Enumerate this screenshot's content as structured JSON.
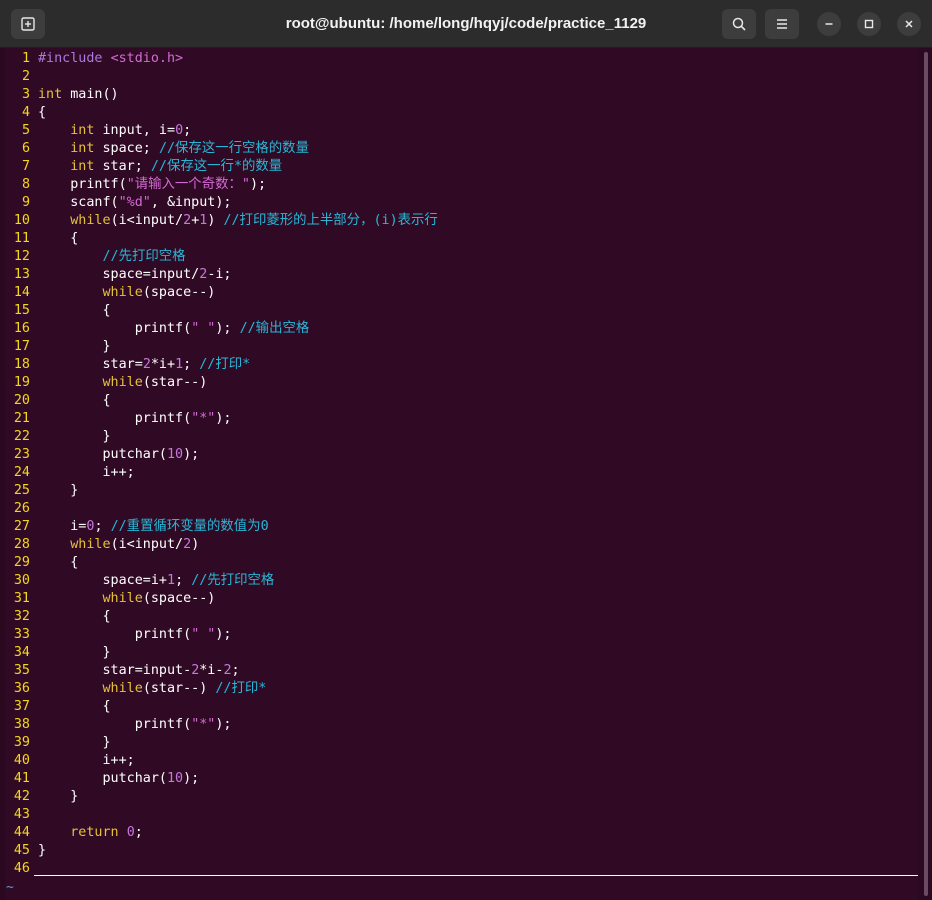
{
  "window": {
    "title": "root@ubuntu: /home/long/hqyj/code/practice_1129"
  },
  "icons": {
    "new_tab": "new-tab-icon",
    "search": "search-icon",
    "menu": "hamburger-menu-icon",
    "minimize": "minimize-icon",
    "maximize": "maximize-icon",
    "close": "close-icon"
  },
  "colors": {
    "background": "#300a24",
    "line_numbers": "#f5d61e",
    "keyword": "#e5c23a",
    "comment": "#29b6d6",
    "string": "#d46ad4",
    "number": "#c678dd"
  },
  "editor": {
    "lines": [
      {
        "num": "1",
        "tokens": [
          [
            "p",
            "#include "
          ],
          [
            "s",
            "<stdio.h>"
          ]
        ]
      },
      {
        "num": "2",
        "tokens": []
      },
      {
        "num": "3",
        "tokens": [
          [
            "k",
            "int"
          ],
          [
            "t",
            " main()"
          ]
        ]
      },
      {
        "num": "4",
        "tokens": [
          [
            "t",
            "{"
          ]
        ]
      },
      {
        "num": "5",
        "tokens": [
          [
            "t",
            "    "
          ],
          [
            "k",
            "int"
          ],
          [
            "t",
            " input, i="
          ],
          [
            "n",
            "0"
          ],
          [
            "t",
            ";"
          ]
        ]
      },
      {
        "num": "6",
        "tokens": [
          [
            "t",
            "    "
          ],
          [
            "k",
            "int"
          ],
          [
            "t",
            " space; "
          ],
          [
            "c",
            "//保存这一行空格的数量"
          ]
        ]
      },
      {
        "num": "7",
        "tokens": [
          [
            "t",
            "    "
          ],
          [
            "k",
            "int"
          ],
          [
            "t",
            " star; "
          ],
          [
            "c",
            "//保存这一行*的数量"
          ]
        ]
      },
      {
        "num": "8",
        "tokens": [
          [
            "t",
            "    printf("
          ],
          [
            "s",
            "\"请输入一个奇数：\""
          ],
          [
            "t",
            ");"
          ]
        ]
      },
      {
        "num": "9",
        "tokens": [
          [
            "t",
            "    scanf("
          ],
          [
            "s",
            "\"%d\""
          ],
          [
            "t",
            ", &input);"
          ]
        ]
      },
      {
        "num": "10",
        "tokens": [
          [
            "t",
            "    "
          ],
          [
            "k",
            "while"
          ],
          [
            "t",
            "(i<input/"
          ],
          [
            "n",
            "2"
          ],
          [
            "t",
            "+"
          ],
          [
            "n",
            "1"
          ],
          [
            "t",
            ") "
          ],
          [
            "c",
            "//打印菱形的上半部分，(i)表示行"
          ]
        ]
      },
      {
        "num": "11",
        "tokens": [
          [
            "t",
            "    {"
          ]
        ]
      },
      {
        "num": "12",
        "tokens": [
          [
            "t",
            "        "
          ],
          [
            "c",
            "//先打印空格"
          ]
        ]
      },
      {
        "num": "13",
        "tokens": [
          [
            "t",
            "        space=input/"
          ],
          [
            "n",
            "2"
          ],
          [
            "t",
            "-i;"
          ]
        ]
      },
      {
        "num": "14",
        "tokens": [
          [
            "t",
            "        "
          ],
          [
            "k",
            "while"
          ],
          [
            "t",
            "(space--)"
          ]
        ]
      },
      {
        "num": "15",
        "tokens": [
          [
            "t",
            "        {"
          ]
        ]
      },
      {
        "num": "16",
        "tokens": [
          [
            "t",
            "            printf("
          ],
          [
            "s",
            "\" \""
          ],
          [
            "t",
            "); "
          ],
          [
            "c",
            "//输出空格"
          ]
        ]
      },
      {
        "num": "17",
        "tokens": [
          [
            "t",
            "        }"
          ]
        ]
      },
      {
        "num": "18",
        "tokens": [
          [
            "t",
            "        star="
          ],
          [
            "n",
            "2"
          ],
          [
            "t",
            "*i+"
          ],
          [
            "n",
            "1"
          ],
          [
            "t",
            "; "
          ],
          [
            "c",
            "//打印*"
          ]
        ]
      },
      {
        "num": "19",
        "tokens": [
          [
            "t",
            "        "
          ],
          [
            "k",
            "while"
          ],
          [
            "t",
            "(star--)"
          ]
        ]
      },
      {
        "num": "20",
        "tokens": [
          [
            "t",
            "        {"
          ]
        ]
      },
      {
        "num": "21",
        "tokens": [
          [
            "t",
            "            printf("
          ],
          [
            "s",
            "\"*\""
          ],
          [
            "t",
            ");"
          ]
        ]
      },
      {
        "num": "22",
        "tokens": [
          [
            "t",
            "        }"
          ]
        ]
      },
      {
        "num": "23",
        "tokens": [
          [
            "t",
            "        putchar("
          ],
          [
            "n",
            "10"
          ],
          [
            "t",
            ");"
          ]
        ]
      },
      {
        "num": "24",
        "tokens": [
          [
            "t",
            "        i++;"
          ]
        ]
      },
      {
        "num": "25",
        "tokens": [
          [
            "t",
            "    }"
          ]
        ]
      },
      {
        "num": "26",
        "tokens": []
      },
      {
        "num": "27",
        "tokens": [
          [
            "t",
            "    i="
          ],
          [
            "n",
            "0"
          ],
          [
            "t",
            "; "
          ],
          [
            "c",
            "//重置循环变量的数值为0"
          ]
        ]
      },
      {
        "num": "28",
        "tokens": [
          [
            "t",
            "    "
          ],
          [
            "k",
            "while"
          ],
          [
            "t",
            "(i<input/"
          ],
          [
            "n",
            "2"
          ],
          [
            "t",
            ")"
          ]
        ]
      },
      {
        "num": "29",
        "tokens": [
          [
            "t",
            "    {"
          ]
        ]
      },
      {
        "num": "30",
        "tokens": [
          [
            "t",
            "        space=i+"
          ],
          [
            "n",
            "1"
          ],
          [
            "t",
            "; "
          ],
          [
            "c",
            "//先打印空格"
          ]
        ]
      },
      {
        "num": "31",
        "tokens": [
          [
            "t",
            "        "
          ],
          [
            "k",
            "while"
          ],
          [
            "t",
            "(space--)"
          ]
        ]
      },
      {
        "num": "32",
        "tokens": [
          [
            "t",
            "        {"
          ]
        ]
      },
      {
        "num": "33",
        "tokens": [
          [
            "t",
            "            printf("
          ],
          [
            "s",
            "\" \""
          ],
          [
            "t",
            ");"
          ]
        ]
      },
      {
        "num": "34",
        "tokens": [
          [
            "t",
            "        }"
          ]
        ]
      },
      {
        "num": "35",
        "tokens": [
          [
            "t",
            "        star=input-"
          ],
          [
            "n",
            "2"
          ],
          [
            "t",
            "*i-"
          ],
          [
            "n",
            "2"
          ],
          [
            "t",
            ";"
          ]
        ]
      },
      {
        "num": "36",
        "tokens": [
          [
            "t",
            "        "
          ],
          [
            "k",
            "while"
          ],
          [
            "t",
            "(star--) "
          ],
          [
            "c",
            "//打印*"
          ]
        ]
      },
      {
        "num": "37",
        "tokens": [
          [
            "t",
            "        {"
          ]
        ]
      },
      {
        "num": "38",
        "tokens": [
          [
            "t",
            "            printf("
          ],
          [
            "s",
            "\"*\""
          ],
          [
            "t",
            ");"
          ]
        ]
      },
      {
        "num": "39",
        "tokens": [
          [
            "t",
            "        }"
          ]
        ]
      },
      {
        "num": "40",
        "tokens": [
          [
            "t",
            "        i++;"
          ]
        ]
      },
      {
        "num": "41",
        "tokens": [
          [
            "t",
            "        putchar("
          ],
          [
            "n",
            "10"
          ],
          [
            "t",
            ");"
          ]
        ]
      },
      {
        "num": "42",
        "tokens": [
          [
            "t",
            "    }"
          ]
        ]
      },
      {
        "num": "43",
        "tokens": []
      },
      {
        "num": "44",
        "tokens": [
          [
            "t",
            "    "
          ],
          [
            "k",
            "return"
          ],
          [
            "t",
            " "
          ],
          [
            "n",
            "0"
          ],
          [
            "t",
            ";"
          ]
        ]
      },
      {
        "num": "45",
        "tokens": [
          [
            "t",
            "}"
          ]
        ]
      },
      {
        "num": "46",
        "tokens": []
      }
    ],
    "empty_marker": "~"
  }
}
